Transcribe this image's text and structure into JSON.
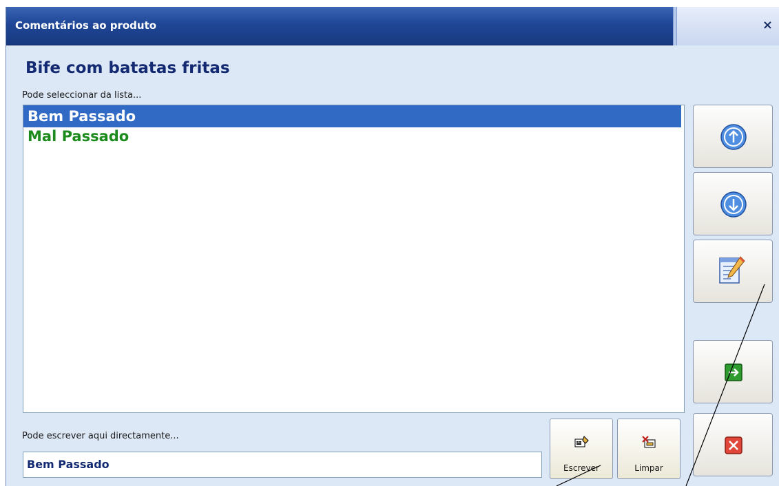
{
  "window": {
    "title": "Comentários ao produto",
    "close_label": "×"
  },
  "product": {
    "name": "Bife com batatas fritas"
  },
  "list": {
    "label": "Pode seleccionar da lista...",
    "items": [
      {
        "label": "Bem Passado",
        "selected": true
      },
      {
        "label": "Mal Passado",
        "selected": false
      }
    ]
  },
  "input": {
    "label": "Pode escrever aqui directamente...",
    "value": "Bem Passado"
  },
  "buttons": {
    "write_label": "Escrever",
    "clear_label": "Limpar"
  },
  "colors": {
    "titlebar": "#1f4696",
    "selection": "#316ac5",
    "item_text": "#1c8a1c",
    "heading": "#132a72"
  }
}
